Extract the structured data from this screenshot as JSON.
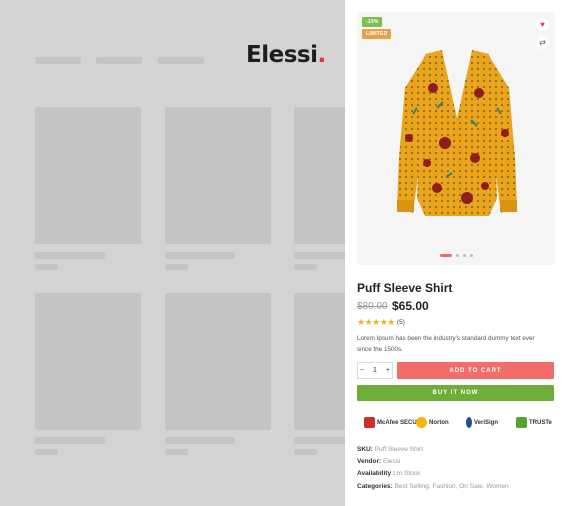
{
  "brand": {
    "logo_text": "Elessi",
    "logo_dot": "."
  },
  "product": {
    "badges": {
      "sale": "-19%",
      "limited": "LIMITED"
    },
    "title": "Puff Sleeve Shirt",
    "old_price": "$80.00",
    "price": "$65.00",
    "stars": "★★★★★",
    "rating_count": "(5)",
    "description": "Lorem Ipsum has been the industry's standard dummy text ever since the 1500s.",
    "quantity": "1",
    "qty_minus": "−",
    "qty_plus": "+",
    "add_to_cart": "ADD TO CART",
    "buy_now": "BUY IT NOW",
    "gallery_count": 4,
    "active_slide": 1
  },
  "trust_badges": [
    {
      "name": "McAfee SECURE",
      "color": "#c9302c"
    },
    {
      "name": "Norton",
      "color": "#f2b705"
    },
    {
      "name": "VeriSign",
      "color": "#2a4d8f"
    },
    {
      "name": "TRUSTe",
      "color": "#5aa02c"
    }
  ],
  "meta": {
    "sku_label": "SKU:",
    "sku": "Puff Sleeve Shirt",
    "vendor_label": "Vendor:",
    "vendor": "Elessi",
    "availability_label": "Availability :",
    "availability": "In Stock",
    "categories_label": "Categories:",
    "categories": "Best Selling, Fashion, On Sale, Women"
  },
  "icons": {
    "wishlist": "heart-icon",
    "compare": "compare-icon"
  },
  "colors": {
    "add_to_cart": "#f26d6a",
    "buy_now": "#6cae37",
    "sale_badge": "#7fbd4f",
    "limited_badge": "#e8a24b",
    "star": "#f1b31c"
  }
}
